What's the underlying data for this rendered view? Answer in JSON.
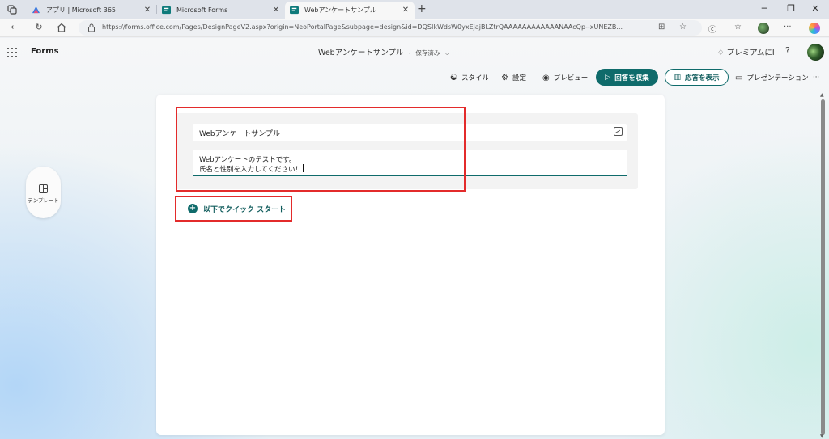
{
  "browser": {
    "tabs": [
      {
        "title": "アプリ | Microsoft 365",
        "active": false
      },
      {
        "title": "Microsoft Forms",
        "active": false
      },
      {
        "title": "Webアンケートサンプル",
        "active": true
      }
    ],
    "new_tab": "+",
    "window": {
      "minimize": "─",
      "maximize": "❐",
      "close": "✕"
    },
    "url": "https://forms.office.com/Pages/DesignPageV2.aspx?origin=NeoPortalPage&subpage=design&id=DQSIkWdsW0yxEjajBLZtrQAAAAAAAAAAAANAAcQp--xUNEZB...",
    "more_label": "···"
  },
  "app": {
    "brand": "Forms",
    "doc_title": "Webアンケートサンプル",
    "doc_separator": "-",
    "saved_status": "保存済み",
    "premium_label": "プレミアムにI",
    "help_label": "?"
  },
  "toolbar": {
    "style_label": "スタイル",
    "settings_label": "設定",
    "preview_label": "プレビュー",
    "collect_label": "回答を収集",
    "responses_label": "応答を表示",
    "present_label": "プレゼンテーション",
    "more_label": "···"
  },
  "sidebar": {
    "template_label": "テンプレート"
  },
  "form": {
    "title": "Webアンケートサンプル",
    "description_line1": "Webアンケートのテストです。",
    "description_line2": "氏名と性別を入力してください！",
    "quick_start_label": "以下でクイック スタート"
  },
  "colors": {
    "accent": "#0f6b6b",
    "highlight": "#e32b2b"
  }
}
